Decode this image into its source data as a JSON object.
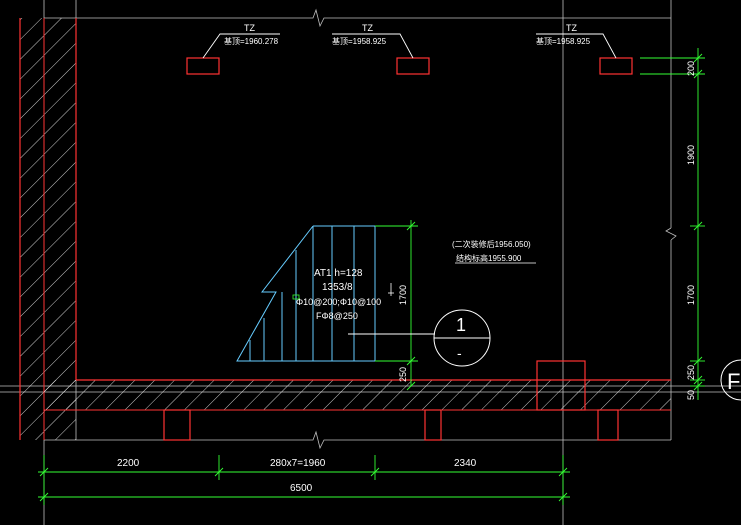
{
  "colors": {
    "background": "#000000",
    "wall_outline": "#ff3333",
    "grid_line": "#bfbfbf",
    "dimension": "#33ff33",
    "stair": "#66ccff",
    "text": "#ffffff",
    "hatch": "#ffffff"
  },
  "columns": [
    {
      "tag": "TZ",
      "elev": "基顶=1960.278"
    },
    {
      "tag": "TZ",
      "elev": "基顶=1958.925"
    },
    {
      "tag": "TZ",
      "elev": "基顶=1958.925"
    }
  ],
  "stair": {
    "line1": "AT1 h=128",
    "line2": "1353/8",
    "line3": "Φ10@200;Φ10@100",
    "line4": "FΦ8@250"
  },
  "platform_note": {
    "line1": "(二次装修后1956.050)",
    "line2": "结构标高1955.900"
  },
  "section_marker": {
    "top": "1",
    "bottom": "-"
  },
  "axis_bubble": "F",
  "dims_bottom": {
    "seg1": "2200",
    "seg2": "280x7=1960",
    "seg3": "2340",
    "total": "6500"
  },
  "dims_right": [
    "200",
    "1900",
    "1700",
    "250",
    "50"
  ],
  "dims_stair": {
    "height": "1700",
    "base": "250"
  }
}
